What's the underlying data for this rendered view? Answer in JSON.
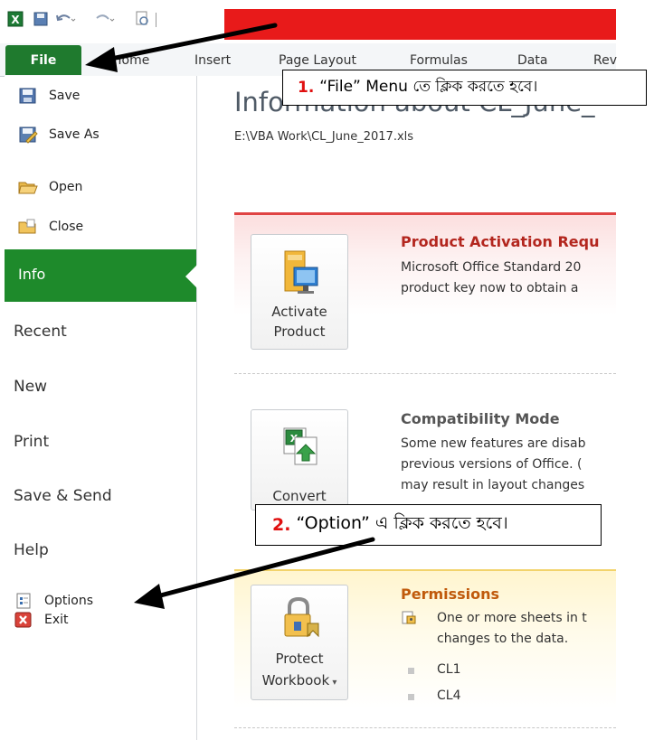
{
  "ribbon": {
    "file": "File",
    "tabs": [
      "Home",
      "Insert",
      "Page Layout",
      "Formulas",
      "Data",
      "Rev"
    ]
  },
  "sidebar": {
    "commands": [
      "Save",
      "Save As",
      "Open",
      "Close"
    ],
    "items": [
      "Info",
      "Recent",
      "New",
      "Print",
      "Save & Send",
      "Help"
    ],
    "bottom_commands": [
      "Options",
      "Exit"
    ],
    "selected": "Info"
  },
  "main": {
    "heading": "Information about CL_June_",
    "path": "E:\\VBA Work\\CL_June_2017.xls",
    "activation": {
      "button_line1": "Activate",
      "button_line2": "Product",
      "title": "Product Activation Requ",
      "body1": "Microsoft Office Standard 20",
      "body2": "product key now to obtain a"
    },
    "compat": {
      "button_line1": "Convert",
      "title": "Compatibility Mode",
      "body1": "Some new features are disab",
      "body2": "previous versions of Office. (",
      "body3": "may result in layout changes"
    },
    "perm": {
      "button_line1": "Protect",
      "button_line2": "Workbook",
      "title": "Permissions",
      "body1": "One or more sheets in t",
      "body2": "changes to the data.",
      "sheets": [
        "CL1",
        "CL4"
      ]
    }
  },
  "callouts": {
    "first": {
      "num": "1.",
      "text": "“File” Menu তে ক্লিক করতে হবে।"
    },
    "second": {
      "num": "2.",
      "text": "“Option” এ ক্লিক করতে হবে।"
    }
  },
  "colors": {
    "file_tab": "#1f7a2e",
    "info_selected": "#1e8a2b",
    "activation_accent": "#e04343",
    "permissions_title": "#c05a0c",
    "activation_title": "#b3261e",
    "annotation_number": "#e01010"
  },
  "icons": [
    "excel-icon",
    "save-icon",
    "undo-icon",
    "redo-icon",
    "print-preview-icon",
    "save-as-icon",
    "open-folder-icon",
    "close-folder-icon",
    "options-icon",
    "exit-icon",
    "activate-product-icon",
    "convert-icon",
    "protect-workbook-icon",
    "sheet-permission-icon"
  ]
}
